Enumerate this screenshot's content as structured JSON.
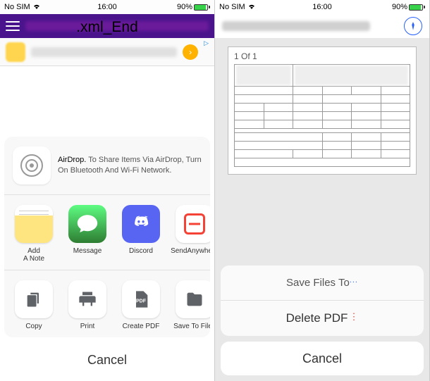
{
  "status_bar": {
    "carrier": "No SIM",
    "time": "16:00",
    "battery_pct": "90%"
  },
  "overlay_text": ".xml_End",
  "left_phone": {
    "airdrop": {
      "title": "AirDrop.",
      "subtitle": "To Share Items Via AirDrop, Turn On Bluetooth And Wi-Fi Network."
    },
    "apps": [
      {
        "key": "notes",
        "label": "Add\nA Note",
        "icon": "notes-icon"
      },
      {
        "key": "message",
        "label": "Message",
        "icon": "message-icon"
      },
      {
        "key": "discord",
        "label": "Discord",
        "icon": "discord-icon"
      },
      {
        "key": "sendanywhere",
        "label": "SendAnywhere",
        "icon": "sendanywhere-icon"
      }
    ],
    "actions": [
      {
        "key": "copy",
        "label": "Copy",
        "icon": "copy-icon"
      },
      {
        "key": "print",
        "label": "Print",
        "icon": "print-icon"
      },
      {
        "key": "createpdf",
        "label": "Create PDF",
        "icon": "pdf-icon"
      },
      {
        "key": "savetofiles",
        "label": "Save To Files",
        "icon": "folder-icon"
      }
    ],
    "cancel_label": "Cancel"
  },
  "right_phone": {
    "page_indicator": "1 Of 1",
    "options": {
      "save_label": "Save Files To",
      "delete_label": "Delete PDF"
    },
    "cancel_label": "Cancel"
  }
}
